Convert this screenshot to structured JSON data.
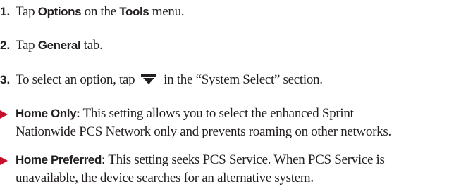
{
  "steps": [
    {
      "number": "1.",
      "text_1": "Tap ",
      "bold_1": "Options",
      "text_2": " on the ",
      "bold_2": "Tools",
      "text_3": " menu."
    },
    {
      "number": "2.",
      "text_1": "Tap ",
      "bold_1": "General",
      "text_2": " tab."
    },
    {
      "number": "3.",
      "text_1": "To select an option, tap ",
      "icon": "dropdown-arrow-icon",
      "text_2": " in the “System Select” section."
    }
  ],
  "bullets": [
    {
      "term": "Home Only:",
      "line_1": " This setting allows you to select the enhanced Sprint",
      "line_2": "Nationwide PCS Network only and prevents roaming on other networks."
    },
    {
      "term": "Home Preferred:",
      "line_1": " This setting seeks PCS Service. When PCS Service is",
      "line_2": "unavailable, the device searches for an alternative system."
    }
  ],
  "colors": {
    "bullet_accent": "#c8102e",
    "text": "#231f20"
  }
}
